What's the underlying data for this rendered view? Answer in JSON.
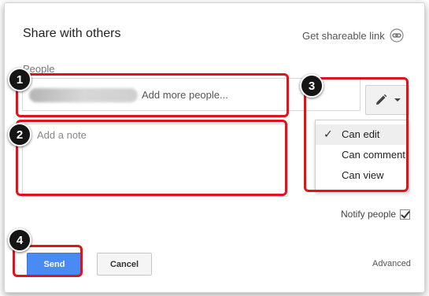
{
  "dialog": {
    "title": "Share with others",
    "shareable_link_label": "Get shareable link",
    "people_label": "People",
    "people_placeholder": "Add more people...",
    "note_placeholder": "Add a note",
    "permission_menu": {
      "items": [
        {
          "label": "Can edit",
          "selected": true
        },
        {
          "label": "Can comment",
          "selected": false
        },
        {
          "label": "Can view",
          "selected": false
        }
      ]
    },
    "notify_label": "Notify people",
    "notify_checked": true,
    "send_label": "Send",
    "cancel_label": "Cancel",
    "advanced_label": "Advanced"
  },
  "annotations": [
    "1",
    "2",
    "3",
    "4"
  ],
  "icons": {
    "link": "link-icon",
    "pencil": "pencil-icon",
    "caret": "chevron-down-icon",
    "check": "checkmark-icon"
  },
  "colors": {
    "send_button": "#4a8af4",
    "annotation_border": "#e0121b",
    "annotation_marker": "#151515"
  }
}
